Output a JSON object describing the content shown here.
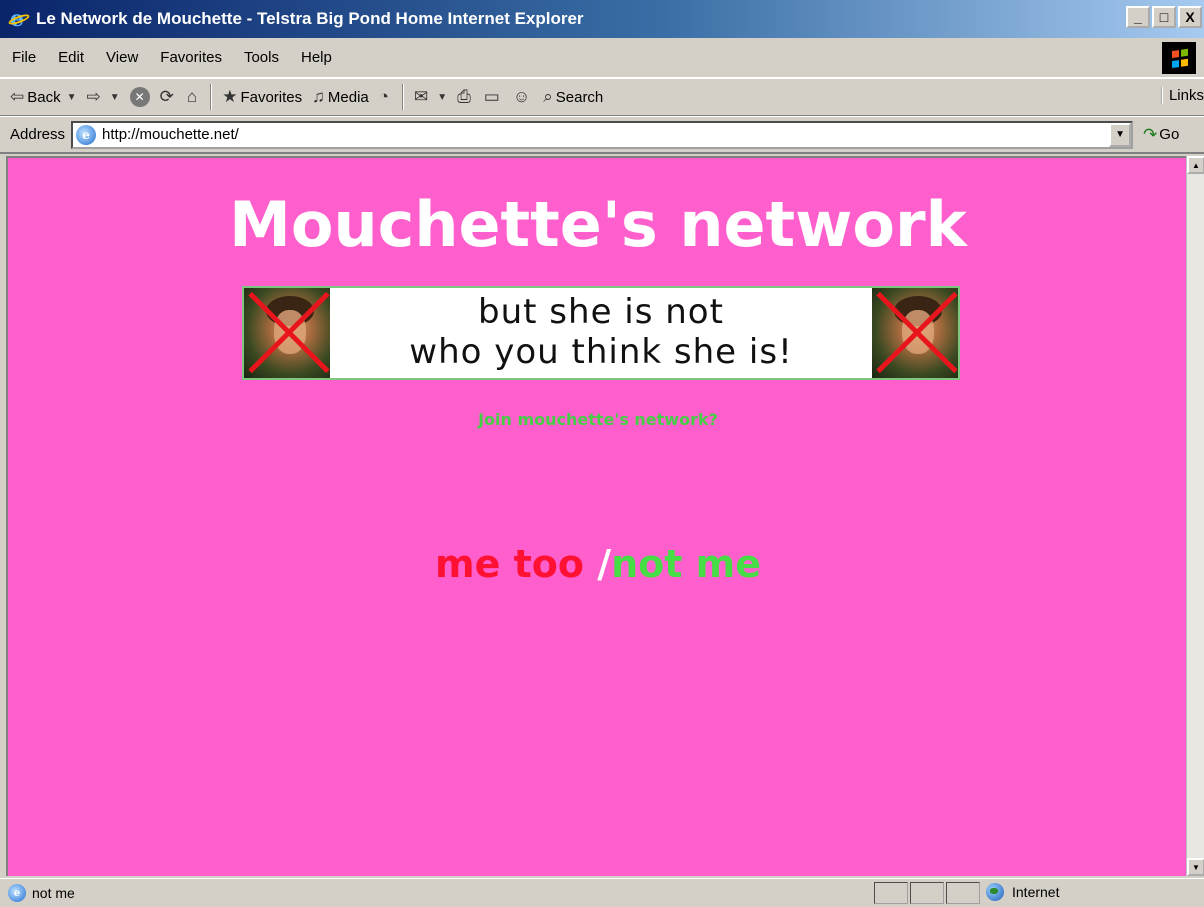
{
  "window": {
    "title": "Le Network de Mouchette - Telstra Big Pond Home Internet Explorer",
    "controls": [
      "_",
      "□",
      "X"
    ]
  },
  "menu": {
    "items": [
      "File",
      "Edit",
      "View",
      "Favorites",
      "Tools",
      "Help"
    ]
  },
  "toolbar": {
    "back_label": "Back",
    "favorites_label": "Favorites",
    "media_label": "Media",
    "search_label": "Search",
    "links_label": "Links"
  },
  "address": {
    "label": "Address",
    "url": "http://mouchette.net/",
    "go_label": "Go"
  },
  "page": {
    "title": "Mouchette's network",
    "banner_line1": "but she is not",
    "banner_line2": "who you think she is!",
    "join_link": "Join mouchette's network?",
    "me_too": "me too",
    "slash": " /",
    "not_me": "not me"
  },
  "status": {
    "text": "not me",
    "zone": "Internet"
  },
  "colors": {
    "page_background": "#ff5fcc",
    "me_too": "#ff1133",
    "not_me": "#46dd46",
    "join_link": "#46cc46"
  }
}
